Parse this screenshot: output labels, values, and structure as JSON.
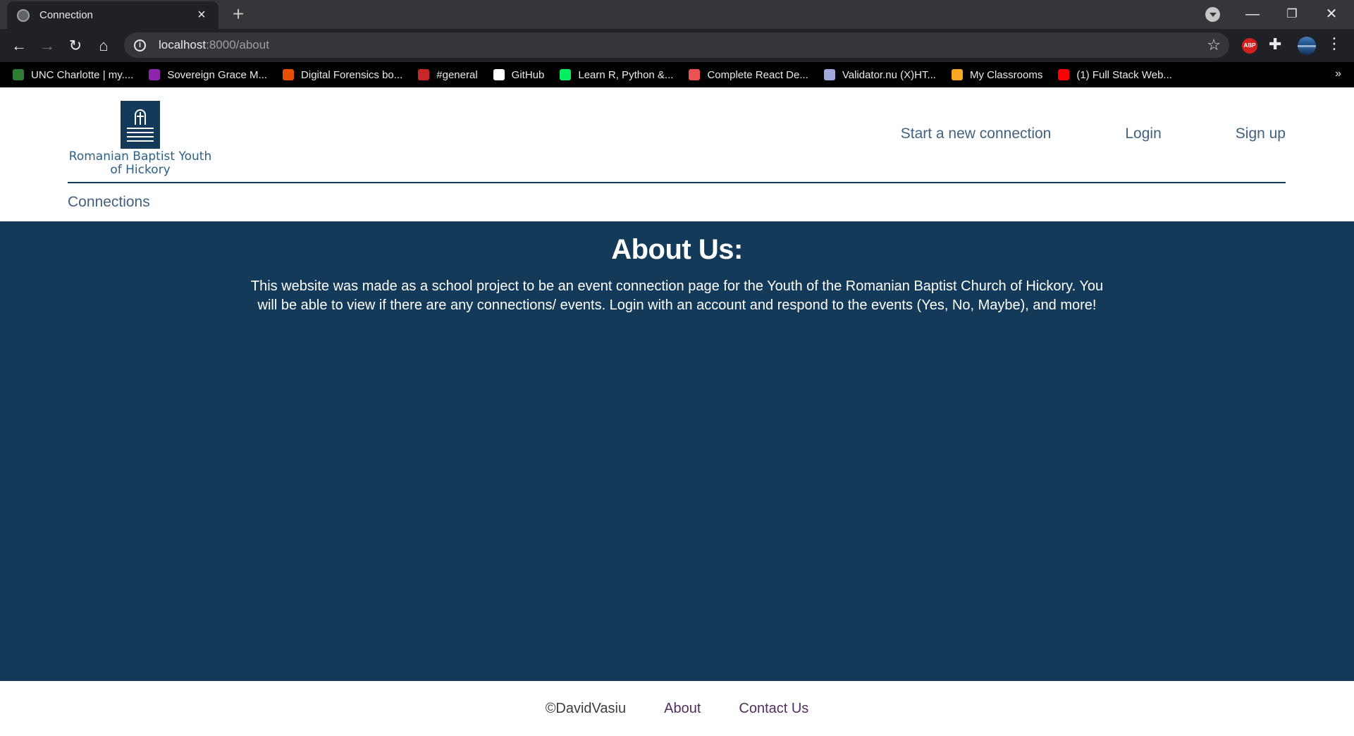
{
  "browser": {
    "tab_title": "Connection",
    "url_host": "localhost",
    "url_path": ":8000/about",
    "bookmarks": [
      {
        "label": "UNC Charlotte | my....",
        "icon": "unc-icon",
        "color": "#2e7d32"
      },
      {
        "label": "Sovereign Grace M...",
        "icon": "sovereign-grace-icon",
        "color": "#8e24aa"
      },
      {
        "label": "Digital Forensics bo...",
        "icon": "ebook-e-icon",
        "color": "#e65100"
      },
      {
        "label": "#general",
        "icon": "slack-calendar-icon",
        "color": "#c62828"
      },
      {
        "label": "GitHub",
        "icon": "github-icon",
        "color": "#ffffff"
      },
      {
        "label": "Learn R, Python &...",
        "icon": "datacamp-icon",
        "color": "#03ef62"
      },
      {
        "label": "Complete React De...",
        "icon": "udemy-icon",
        "color": "#ec5252"
      },
      {
        "label": "Validator.nu (X)HT...",
        "icon": "validator-icon",
        "color": "#9fa8da"
      },
      {
        "label": "My Classrooms",
        "icon": "classroom-box-icon",
        "color": "#f9a825"
      },
      {
        "label": "(1) Full Stack Web...",
        "icon": "youtube-icon",
        "color": "#ff0000"
      }
    ],
    "more_symbol": "»"
  },
  "site": {
    "logo_text_line1": "Romanian Baptist Youth",
    "logo_text_line2": "of Hickory",
    "nav": {
      "new_connection": "Start a new connection",
      "login": "Login",
      "signup": "Sign up"
    },
    "sub_nav": {
      "connections": "Connections"
    },
    "brand_color": "#143a59"
  },
  "main": {
    "heading": "About Us:",
    "body": "This website was made as a school project to be an event connection page for the Youth of the Romanian Baptist Church of Hickory. You will be able to view if there are any connections/ events. Login with an account and respond to the events (Yes, No, Maybe), and more!"
  },
  "footer": {
    "copyright": "©DavidVasiu",
    "about": "About",
    "contact": "Contact Us"
  }
}
